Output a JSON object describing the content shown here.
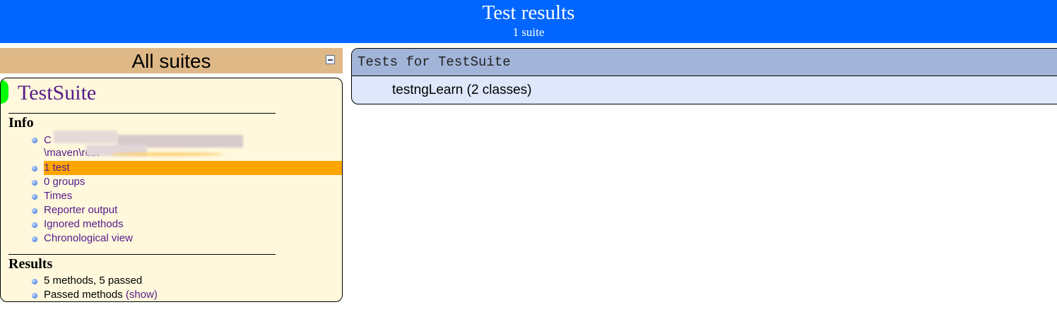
{
  "banner": {
    "title": "Test results",
    "subtitle": "1 suite"
  },
  "navigator": {
    "title": "All suites",
    "collapse_icon": "collapse-icon",
    "suite": {
      "name": "TestSuite",
      "status_color": "#00ff00",
      "info": {
        "heading": "Info",
        "path_fragment_line1": "C",
        "path_fragment_line2": "\\maven\\rest",
        "items": [
          "1 test",
          "0 groups",
          "Times",
          "Reporter output",
          "Ignored methods",
          "Chronological view"
        ]
      },
      "results": {
        "heading": "Results",
        "summary": "5 methods, 5 passed",
        "passed_label": "Passed methods",
        "show_link": "(show)"
      }
    }
  },
  "main": {
    "header": "Tests for TestSuite",
    "tests": [
      "testngLearn (2 classes)"
    ]
  },
  "colors": {
    "banner": "#0066ff",
    "navigator_header": "#deb887",
    "suite_panel": "#fff8dc",
    "highlight": "#ffa500",
    "main_header": "#a2b5d9",
    "main_body": "#dfe8fb",
    "link": "#551a8b"
  }
}
